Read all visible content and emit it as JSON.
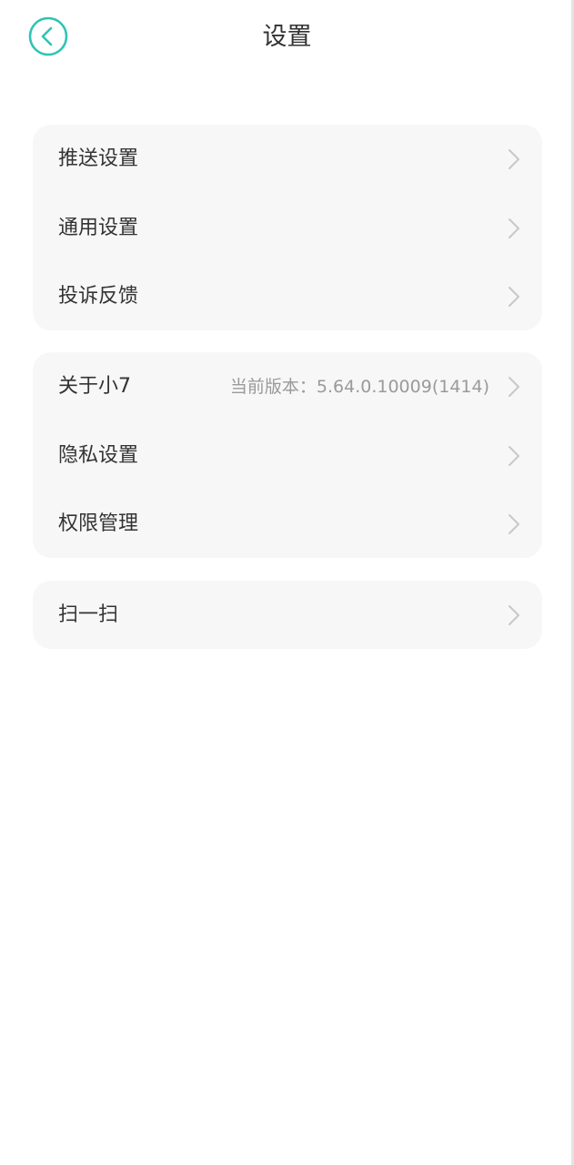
{
  "header": {
    "title": "设置",
    "back_icon": "chevron-left-circle-icon",
    "accent_color": "#2ec4b6"
  },
  "groups": [
    {
      "items": [
        {
          "label": "推送设置",
          "icon": "chevron-right-icon"
        },
        {
          "label": "通用设置",
          "icon": "chevron-right-icon"
        },
        {
          "label": "投诉反馈",
          "icon": "chevron-right-icon"
        }
      ]
    },
    {
      "items": [
        {
          "label": "关于小7",
          "value": "当前版本：5.64.0.10009(1414)",
          "icon": "chevron-right-icon"
        },
        {
          "label": "隐私设置",
          "icon": "chevron-right-icon"
        },
        {
          "label": "权限管理",
          "icon": "chevron-right-icon"
        }
      ]
    },
    {
      "items": [
        {
          "label": "扫一扫",
          "icon": "chevron-right-icon"
        }
      ]
    }
  ]
}
